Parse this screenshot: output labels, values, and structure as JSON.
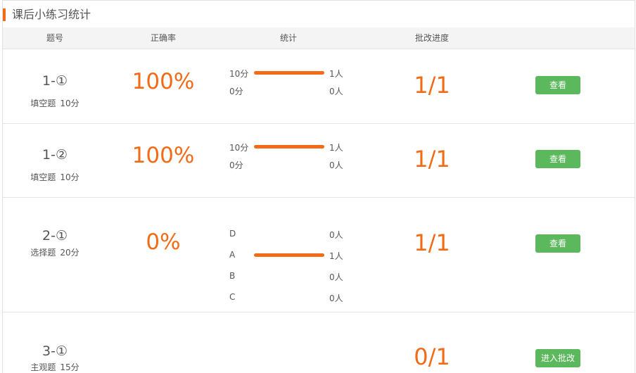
{
  "title": "课后小练习统计",
  "columns": {
    "number": "题号",
    "accuracy": "正确率",
    "stats": "统计",
    "progress": "批改进度"
  },
  "questions": [
    {
      "number": "1-①",
      "type": "填空题",
      "score": "10分",
      "accuracy": "100%",
      "progress": "1/1",
      "action": "查看",
      "stats": [
        {
          "label": "10分",
          "count": "1人",
          "fraction": 1.0
        },
        {
          "label": "0分",
          "count": "0人",
          "fraction": 0.0
        }
      ]
    },
    {
      "number": "1-②",
      "type": "填空题",
      "score": "10分",
      "accuracy": "100%",
      "progress": "1/1",
      "action": "查看",
      "stats": [
        {
          "label": "10分",
          "count": "1人",
          "fraction": 1.0
        },
        {
          "label": "0分",
          "count": "0人",
          "fraction": 0.0
        }
      ]
    },
    {
      "number": "2-①",
      "type": "选择题",
      "score": "20分",
      "accuracy": "0%",
      "progress": "1/1",
      "action": "查看",
      "stats": [
        {
          "label": "D",
          "count": "0人",
          "fraction": 0.0
        },
        {
          "label": "A",
          "count": "1人",
          "fraction": 1.0
        },
        {
          "label": "B",
          "count": "0人",
          "fraction": 0.0
        },
        {
          "label": "C",
          "count": "0人",
          "fraction": 0.0
        }
      ]
    },
    {
      "number": "3-①",
      "type": "主观题",
      "score": "15分",
      "accuracy": "",
      "progress": "0/1",
      "action": "进入批改",
      "stats": []
    }
  ],
  "colors": {
    "accent": "#f26b17",
    "button": "#5cb85c"
  }
}
